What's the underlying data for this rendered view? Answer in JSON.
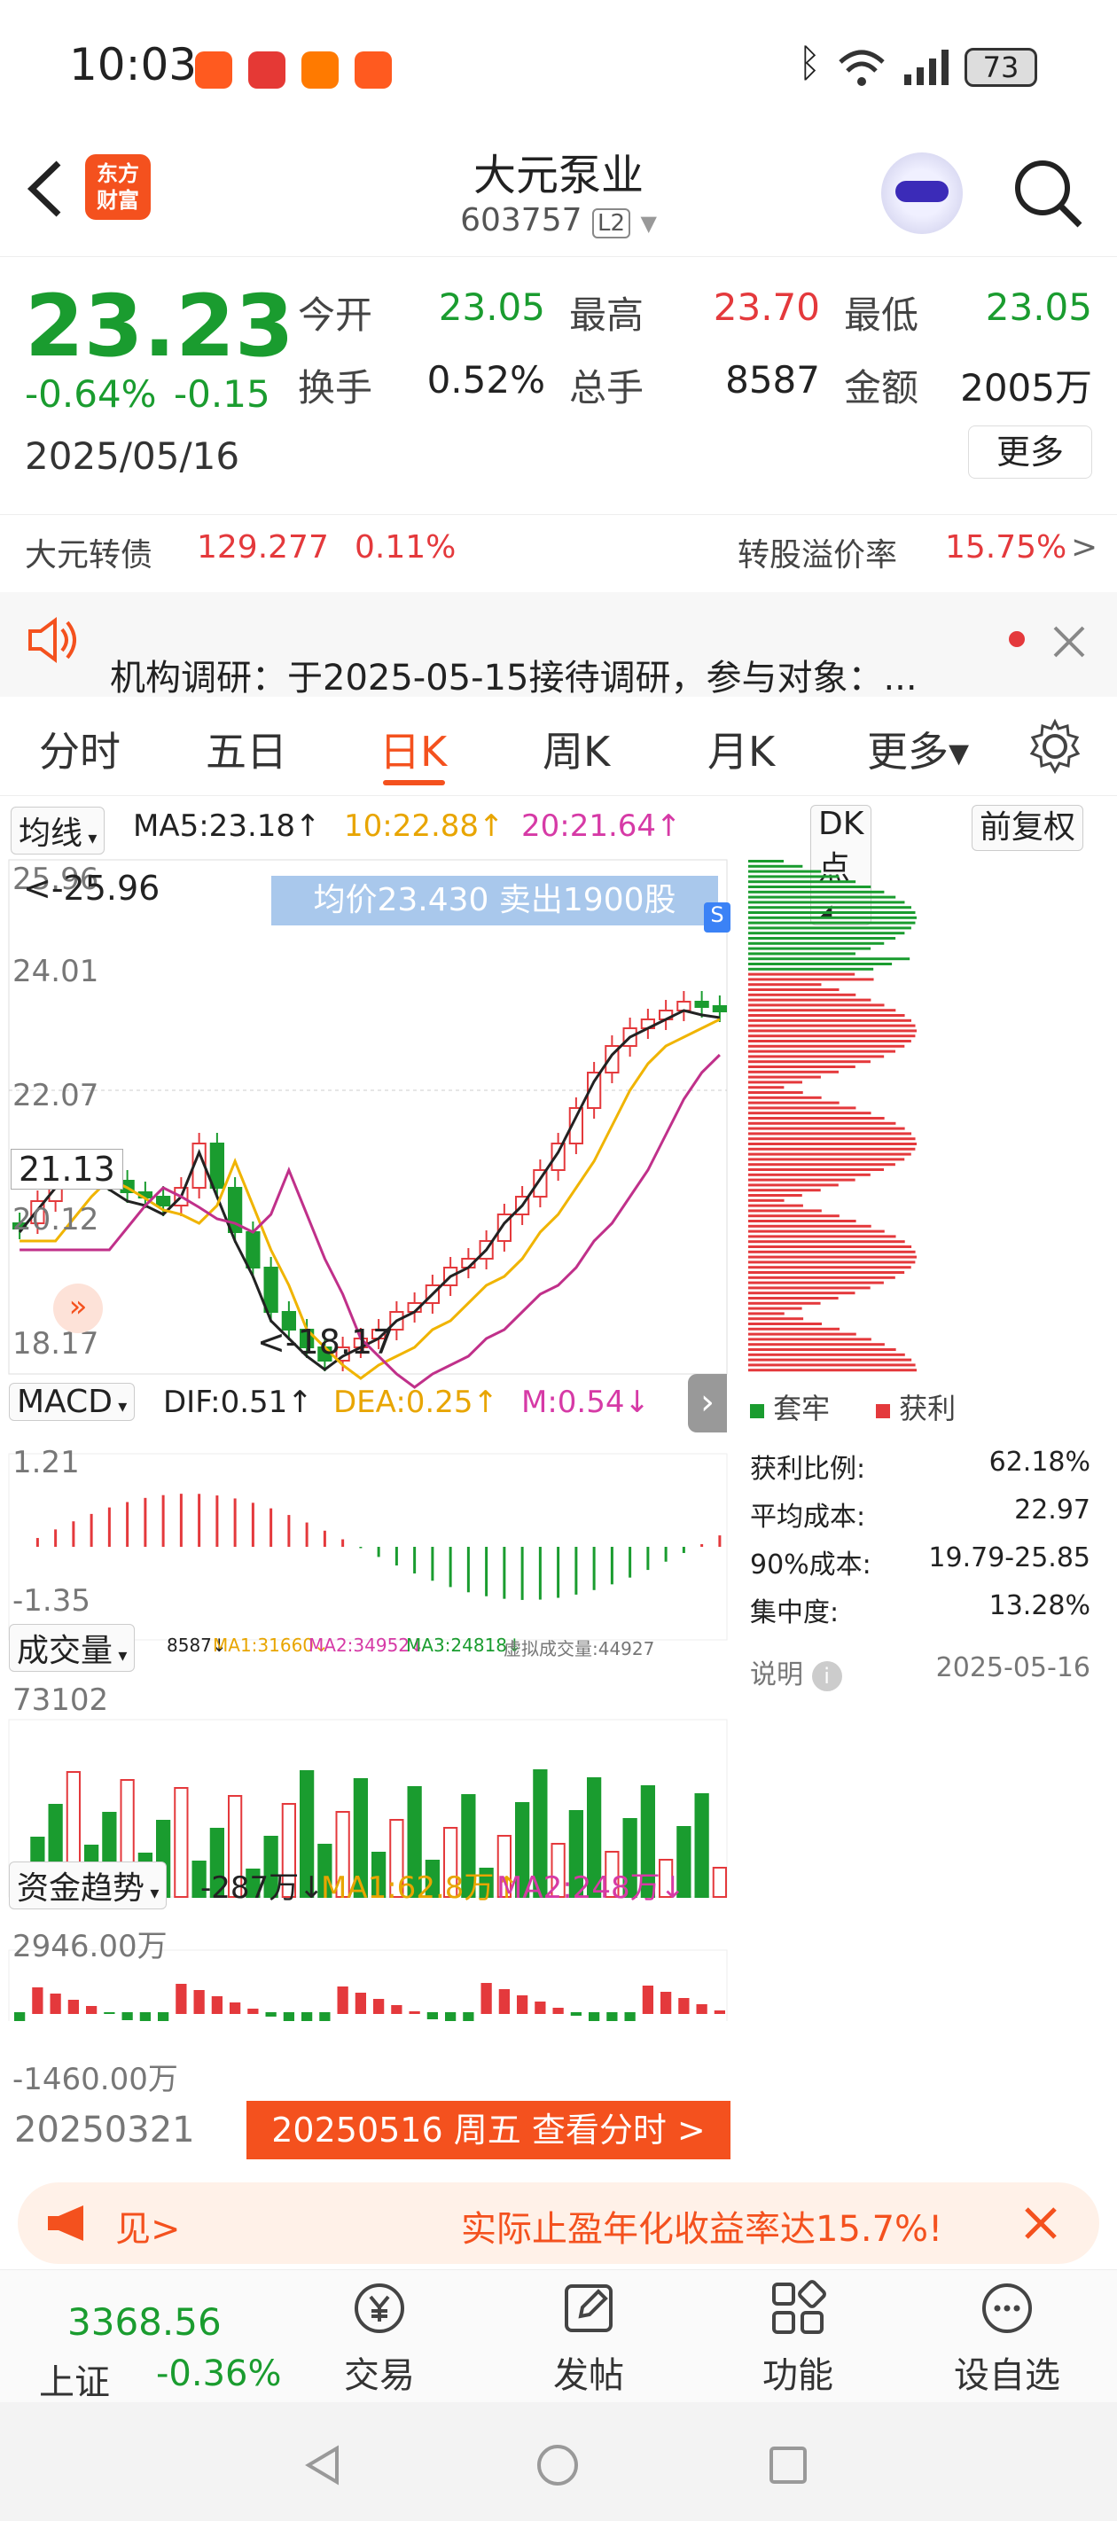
{
  "status": {
    "time": "10:03",
    "battery": "73"
  },
  "header": {
    "title": "大元泵业",
    "code": "603757",
    "level": "L2",
    "logo_l1": "东方",
    "logo_l2": "财富"
  },
  "quote": {
    "price": "23.23",
    "change_pct": "-0.64%",
    "change": "-0.15",
    "date": "2025/05/16",
    "open_label": "今开",
    "open": "23.05",
    "high_label": "最高",
    "high": "23.70",
    "low_label": "最低",
    "low": "23.05",
    "turnover_label": "换手",
    "turnover": "0.52%",
    "volume_label": "总手",
    "volume": "8587",
    "amount_label": "金额",
    "amount": "2005万",
    "more": "更多"
  },
  "bond": {
    "name": "大元转债",
    "price": "129.277",
    "pct": "0.11%",
    "premium_label": "转股溢价率",
    "premium": "15.75%",
    "arrow": ">"
  },
  "notice": {
    "text": "机构调研：于2025-05-15接待调研，参与对象：..."
  },
  "tabs": [
    "分时",
    "五日",
    "日K",
    "周K",
    "月K",
    "更多▾"
  ],
  "kline": {
    "ma_select": "均线",
    "ma5": "MA5:23.18↑",
    "ma10": "10:22.88↑",
    "ma20": "20:21.64↑",
    "dk": "DK点",
    "fq": "前复权",
    "banner": "均价23.430  卖出1900股",
    "ymax": "25.96",
    "y2": "24.01",
    "y3": "22.07",
    "ycur": "21.13",
    "y4": "20.12",
    "ymin": "18.17",
    "max_mark": "<-25.96",
    "min_mark": "<-18.17"
  },
  "macd": {
    "select": "MACD",
    "dif": "DIF:0.51↑",
    "dea": "DEA:0.25↑",
    "m": "M:0.54↓",
    "ymax": "1.21",
    "ymin": "-1.35"
  },
  "vol": {
    "select": "成交量",
    "v": "8587↓",
    "ma1": "MA1:31660↓",
    "ma2": "MA2:34952↓",
    "ma3": "MA3:24818↓",
    "virt": "虚拟成交量:44927",
    "ymax": "73102"
  },
  "fund": {
    "select": "资金趋势",
    "v": "-287万↓",
    "ma1": "MA1:62.8万↑",
    "ma2": "MA2:248万↓",
    "ymax": "2946.00万",
    "ymin": "-1460.00万"
  },
  "footer": {
    "start_date": "20250321",
    "btn": "20250516 周五 查看分时 >"
  },
  "chip": {
    "legend_trap": "套牢",
    "legend_profit": "获利",
    "stats": [
      {
        "label": "获利比例:",
        "value": "62.18%"
      },
      {
        "label": "平均成本:",
        "value": "22.97"
      },
      {
        "label": "90%成本:",
        "value": "19.79-25.85"
      },
      {
        "label": "集中度:",
        "value": "13.28%"
      }
    ],
    "note": "说明",
    "date": "2025-05-16"
  },
  "ad": {
    "left": "见>",
    "text": "实际止盈年化收益率达15.7%!"
  },
  "bottom": {
    "index_value": "3368.56",
    "index_name": "上证",
    "index_pct": "-0.36%",
    "items": [
      "交易",
      "发帖",
      "功能",
      "设自选"
    ]
  },
  "colors": {
    "accent": "#f4511e",
    "up": "#e4393c",
    "down": "#1a9c2f"
  }
}
